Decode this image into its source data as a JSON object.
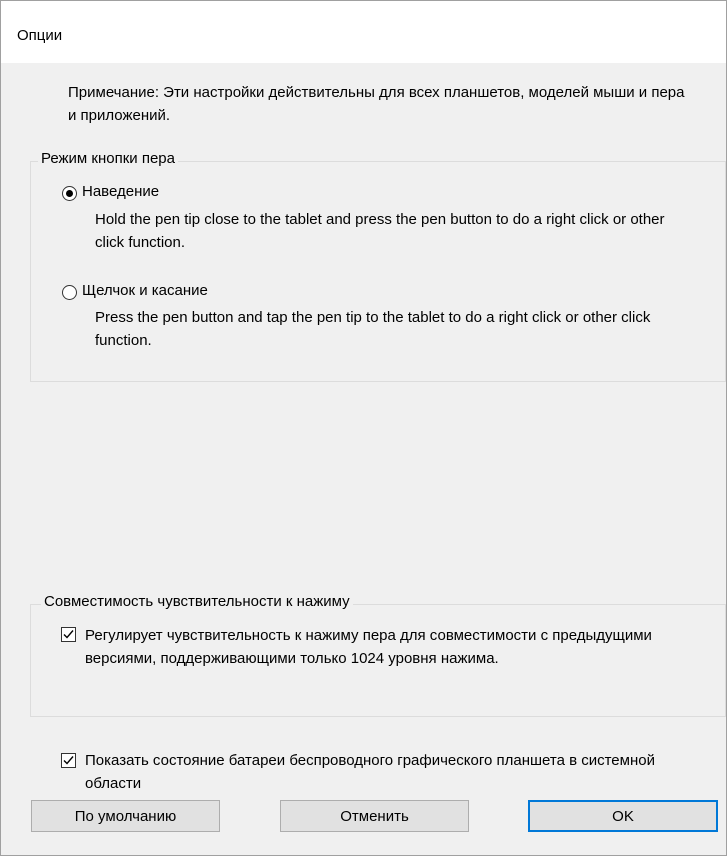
{
  "dialog": {
    "title": "Опции",
    "note": "Примечание: Эти настройки действительны для всех планшетов, моделей мыши и пера и приложений."
  },
  "pen_button_mode": {
    "label": "Режим кнопки пера",
    "selected": "hover",
    "options": [
      {
        "label": "Наведение",
        "description": "Hold the pen tip close to the tablet and press the pen button to do a right click or other click function."
      },
      {
        "label": "Щелчок и касание",
        "description": "Press the pen button and tap the pen tip to the tablet to do a right click or other click function."
      }
    ]
  },
  "pressure_compat": {
    "label": "Совместимость чувствительности к нажиму",
    "checkbox_label": "Регулирует чувствительность к нажиму пера для совместимости с предыдущими версиями, поддерживающими только 1024 уровня нажима.",
    "checked": true
  },
  "battery": {
    "checkbox_label": "Показать состояние батареи беспроводного графического планшета в системной области",
    "checked": true
  },
  "buttons": {
    "default_label": "По умолчанию",
    "cancel_label": "Отменить",
    "ok_label": "OK"
  },
  "colors": {
    "dialog_bg": "#f0f0f0",
    "accent": "#0078d7"
  }
}
